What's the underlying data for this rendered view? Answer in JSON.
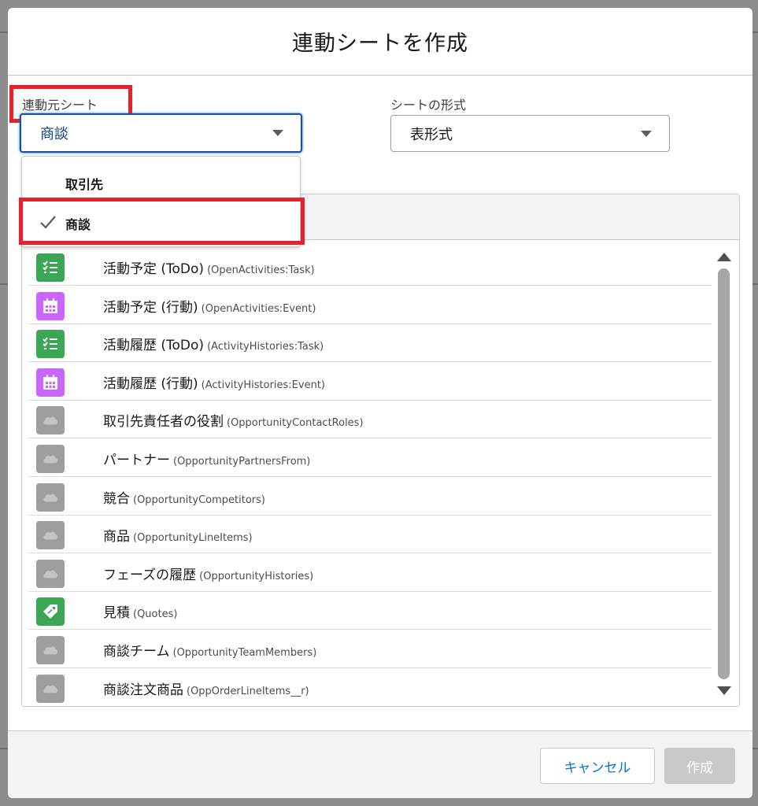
{
  "modal": {
    "title": "連動シートを作成"
  },
  "source_sheet": {
    "label": "連動元シート",
    "selected": "商談",
    "options": [
      {
        "label": "取引先",
        "checked": false
      },
      {
        "label": "商談",
        "checked": true
      }
    ]
  },
  "sheet_format": {
    "label": "シートの形式",
    "selected": "表形式"
  },
  "related_list": [
    {
      "label": "活動予定 (ToDo)",
      "api": "(OpenActivities:Task)",
      "icon": "task-icon",
      "color": "#3ba755"
    },
    {
      "label": "活動予定 (行動)",
      "api": "(OpenActivities:Event)",
      "icon": "calendar-icon",
      "color": "#cb65ff"
    },
    {
      "label": "活動履歴 (ToDo)",
      "api": "(ActivityHistories:Task)",
      "icon": "task-icon",
      "color": "#3ba755"
    },
    {
      "label": "活動履歴 (行動)",
      "api": "(ActivityHistories:Event)",
      "icon": "calendar-icon",
      "color": "#cb65ff"
    },
    {
      "label": "取引先責任者の役割",
      "api": "(OpportunityContactRoles)",
      "icon": "cloud-icon",
      "color": "#9e9e9e"
    },
    {
      "label": "パートナー",
      "api": "(OpportunityPartnersFrom)",
      "icon": "cloud-icon",
      "color": "#9e9e9e"
    },
    {
      "label": "競合",
      "api": "(OpportunityCompetitors)",
      "icon": "cloud-icon",
      "color": "#9e9e9e"
    },
    {
      "label": "商品",
      "api": "(OpportunityLineItems)",
      "icon": "cloud-icon",
      "color": "#9e9e9e"
    },
    {
      "label": "フェーズの履歴",
      "api": "(OpportunityHistories)",
      "icon": "cloud-icon",
      "color": "#9e9e9e"
    },
    {
      "label": "見積",
      "api": "(Quotes)",
      "icon": "tag-icon",
      "color": "#3ba755"
    },
    {
      "label": "商談チーム",
      "api": "(OpportunityTeamMembers)",
      "icon": "cloud-icon",
      "color": "#9e9e9e"
    },
    {
      "label": "商談注文商品",
      "api": "(OppOrderLineItems__r)",
      "icon": "cloud-icon",
      "color": "#9e9e9e"
    }
  ],
  "footer": {
    "cancel_label": "キャンセル",
    "create_label": "作成"
  },
  "colors": {
    "highlight": "#e8202c",
    "brand_blue": "#0176d3",
    "focus_border": "#1b5297"
  }
}
